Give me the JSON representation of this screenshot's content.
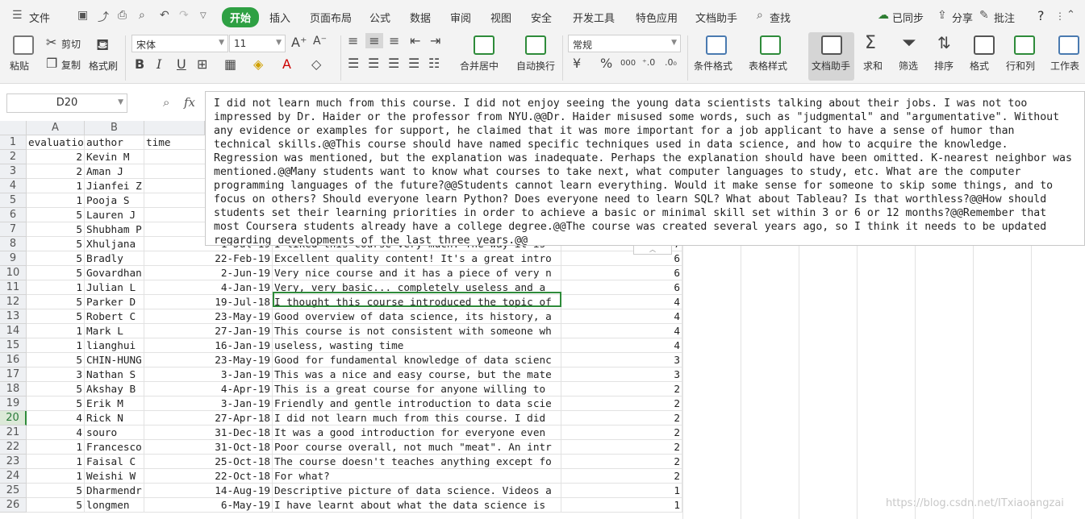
{
  "menubar": {
    "file": "文件",
    "tabs": [
      "开始",
      "插入",
      "页面布局",
      "公式",
      "数据",
      "审阅",
      "视图",
      "安全",
      "开发工具",
      "特色应用",
      "文档助手"
    ],
    "search": "查找",
    "synced": "已同步",
    "share": "分享",
    "comment": "批注",
    "help": "?"
  },
  "ribbon": {
    "paste": "粘贴",
    "cut": "剪切",
    "copy": "复制",
    "format_painter": "格式刷",
    "font_name": "宋体",
    "font_size": "11",
    "bold": "B",
    "italic": "I",
    "underline": "U",
    "merge_center": "合并居中",
    "wrap_text": "自动换行",
    "number_format": "常规",
    "percent": "%",
    "thousands": "000",
    "conditional_format": "条件格式",
    "table_style": "表格样式",
    "doc_assistant": "文档助手",
    "sum": "求和",
    "filter": "筛选",
    "sort": "排序",
    "format": "格式",
    "rows_cols": "行和列",
    "worksheet": "工作表"
  },
  "formula_bar": {
    "name_box": "D20",
    "fx": "fx",
    "content": "I did not learn much from this course. I did not enjoy seeing the young data scientists talking about their jobs. I was not too impressed by Dr. Haider or the professor from NYU.@@Dr. Haider misused some words, such as \"judgmental\" and \"argumentative\". Without any evidence or examples for support, he claimed that it was more important for a job applicant to have a sense of humor than technical skills.@@This course should have named specific techniques used in data science, and how to acquire the knowledge. Regression was mentioned, but the explanation was inadequate. Perhaps the explanation should have been omitted. K-nearest neighbor was mentioned.@@Many students want to know what courses to take next, what computer languages to study, etc. What are the computer programming languages of the future?@@Students cannot learn everything. Would it make sense for someone to skip some things, and to focus on others? Should everyone learn Python? Does everyone need to learn SQL? What about Tableau? Is that worthless?@@How should students set their learning priorities in order to achieve a basic or minimal skill set within 3 or 6 or 12 months?@@Remember that most Coursera students already have a college degree.@@The course was created several years ago, so I think it needs to be updated regarding developments of the last three years.@@"
  },
  "grid": {
    "columns": [
      "A",
      "B"
    ],
    "rows": [
      {
        "n": "1",
        "a": "evaluation",
        "b": "author",
        "c": "time",
        "d": "",
        "e": ""
      },
      {
        "n": "2",
        "a": "2",
        "b": "Kevin M",
        "c": "",
        "d": "",
        "e": ""
      },
      {
        "n": "3",
        "a": "2",
        "b": "Aman J",
        "c": "",
        "d": "",
        "e": ""
      },
      {
        "n": "4",
        "a": "1",
        "b": "Jianfei Z",
        "c": "",
        "d": "",
        "e": ""
      },
      {
        "n": "5",
        "a": "1",
        "b": "Pooja S",
        "c": "",
        "d": "",
        "e": ""
      },
      {
        "n": "6",
        "a": "5",
        "b": "Lauren J",
        "c": "",
        "d": "",
        "e": ""
      },
      {
        "n": "7",
        "a": "5",
        "b": "Shubham P",
        "c": "",
        "d": "",
        "e": ""
      },
      {
        "n": "8",
        "a": "5",
        "b": "Xhuljana",
        "c": "1-Jul-19",
        "d": "I liked this course very much. The way it is",
        "e": "7"
      },
      {
        "n": "9",
        "a": "5",
        "b": "Bradly",
        "c": "22-Feb-19",
        "d": "Excellent quality content! It's a great intro",
        "e": "6"
      },
      {
        "n": "10",
        "a": "5",
        "b": "Govardhan",
        "c": "2-Jun-19",
        "d": "Very nice course and it has a piece of very n",
        "e": "6"
      },
      {
        "n": "11",
        "a": "1",
        "b": "Julian L",
        "c": "4-Jan-19",
        "d": "Very, very basic... completely useless and a",
        "e": "6"
      },
      {
        "n": "12",
        "a": "5",
        "b": "Parker D",
        "c": "19-Jul-18",
        "d": "I thought this course introduced the topic of",
        "e": "4"
      },
      {
        "n": "13",
        "a": "5",
        "b": "Robert C",
        "c": "23-May-19",
        "d": "Good overview of data science, its history, a",
        "e": "4"
      },
      {
        "n": "14",
        "a": "1",
        "b": "Mark L",
        "c": "27-Jan-19",
        "d": "This course is not consistent with someone wh",
        "e": "4"
      },
      {
        "n": "15",
        "a": "1",
        "b": "lianghui",
        "c": "16-Jan-19",
        "d": "useless, wasting time",
        "e": "4"
      },
      {
        "n": "16",
        "a": "5",
        "b": "CHIN-HUNG",
        "c": "23-May-19",
        "d": "Good for fundamental knowledge of data scienc",
        "e": "3"
      },
      {
        "n": "17",
        "a": "3",
        "b": "Nathan S",
        "c": "3-Jan-19",
        "d": "This was a nice and easy course, but the mate",
        "e": "3"
      },
      {
        "n": "18",
        "a": "5",
        "b": "Akshay B",
        "c": "4-Apr-19",
        "d": "This is a great course for anyone willing to",
        "e": "2"
      },
      {
        "n": "19",
        "a": "5",
        "b": "Erik M",
        "c": "3-Jan-19",
        "d": "Friendly and gentle introduction to data scie",
        "e": "2"
      },
      {
        "n": "20",
        "a": "4",
        "b": "Rick N",
        "c": "27-Apr-18",
        "d": "I did not learn much from this course. I did",
        "e": "2"
      },
      {
        "n": "21",
        "a": "4",
        "b": "souro",
        "c": "31-Dec-18",
        "d": "It was a good introduction for everyone even",
        "e": "2"
      },
      {
        "n": "22",
        "a": "1",
        "b": "Francesco",
        "c": "31-Oct-18",
        "d": "Poor course overall, not much \"meat\". An intr",
        "e": "2"
      },
      {
        "n": "23",
        "a": "1",
        "b": "Faisal C",
        "c": "25-Oct-18",
        "d": "The course doesn't teaches anything except fo",
        "e": "2"
      },
      {
        "n": "24",
        "a": "1",
        "b": "Weishi W",
        "c": "22-Oct-18",
        "d": "For what?",
        "e": "2"
      },
      {
        "n": "25",
        "a": "5",
        "b": "Dharmendr",
        "c": "14-Aug-19",
        "d": "Descriptive picture of data science. Videos a",
        "e": "1"
      },
      {
        "n": "26",
        "a": "5",
        "b": "longmen",
        "c": "6-May-19",
        "d": "I have learnt about what the data science is",
        "e": "1"
      }
    ]
  },
  "watermark": "https://blog.csdn.net/ITxiaoangzai"
}
